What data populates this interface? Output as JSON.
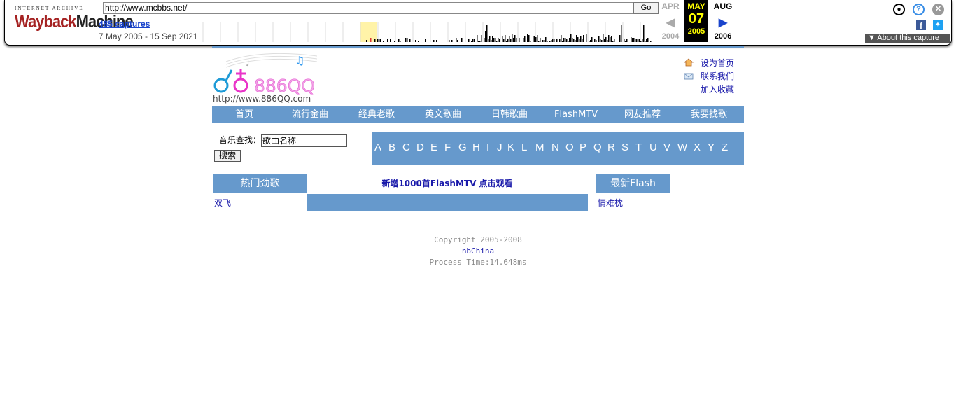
{
  "wayback": {
    "logo_top": "INTERNET ARCHIVE",
    "logo_main_a": "Wayback",
    "logo_main_b": "Machine",
    "url": "http://www.mcbbs.net/",
    "go_label": "Go",
    "captures": "485 captures",
    "range": "7 May 2005 - 15 Sep 2021",
    "cal_prev_month": "APR",
    "cal_prev_year": "2004",
    "cal_month": "MAY",
    "cal_day": "07",
    "cal_year": "2005",
    "cal_next_month": "AUG",
    "cal_next_year": "2006",
    "about": "About this capture"
  },
  "site": {
    "logo_url": "http://www.886QQ.com",
    "logo_text": "886QQ",
    "links": [
      "设为首页",
      "联系我们",
      "加入收藏"
    ],
    "nav": [
      "首页",
      "流行金曲",
      "经典老歌",
      "英文歌曲",
      "日韩歌曲",
      "FlashMTV",
      "网友推荐",
      "我要找歌"
    ],
    "search_label": "音乐查找：",
    "search_value": "歌曲名称",
    "search_button": "搜索",
    "alphabet": [
      "A",
      "B",
      "C",
      "D",
      "E",
      "F",
      "G",
      "H",
      "I",
      "J",
      "K",
      "L",
      "M",
      "N",
      "O",
      "P",
      "Q",
      "R",
      "S",
      "T",
      "U",
      "V",
      "W",
      "X",
      "Y",
      "Z"
    ],
    "hot_title": "热门劲歌",
    "hot_item": "双飞",
    "center_link": "新增1000首FlashMTV 点击观看",
    "flash_title": "最新Flash",
    "flash_item": "情难枕",
    "footer_copyright": "Copyright 2005-2008",
    "footer_brand": "nbChina",
    "footer_time": "Process Time:14.648ms"
  },
  "colors": {
    "nav_blue": "#6699cc",
    "link_blue": "#1a1aaa",
    "wayback_red": "#a52222"
  }
}
